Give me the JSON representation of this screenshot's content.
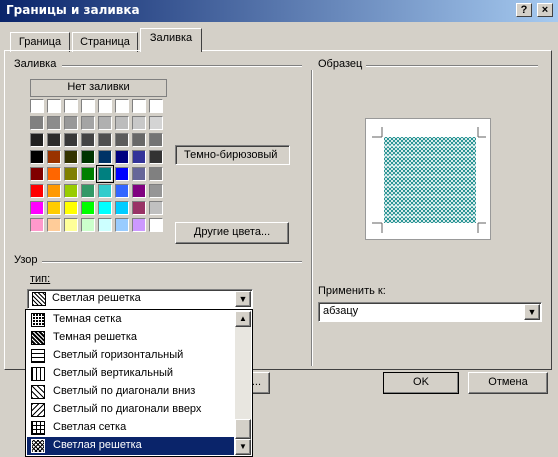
{
  "window": {
    "title": "Границы и заливка",
    "help_btn": "?",
    "close_btn": "×"
  },
  "tabs": [
    "Граница",
    "Страница",
    "Заливка"
  ],
  "fill": {
    "group_label": "Заливка",
    "no_fill_label": "Нет заливки",
    "selected_color_name": "Темно-бирюзовый",
    "other_colors_label": "Другие цвета...",
    "palette": [
      [
        "#ffffff",
        "#ffffff",
        "#ffffff",
        "#ffffff",
        "#ffffff",
        "#ffffff",
        "#ffffff",
        "#ffffff"
      ],
      [
        "#808080",
        "#8c8c8c",
        "#989898",
        "#a4a4a4",
        "#b0b0b0",
        "#bcbcbc",
        "#c8c8c8",
        "#d4d4d4"
      ],
      [
        "#202020",
        "#2c2c2c",
        "#383838",
        "#444444",
        "#505050",
        "#5c5c5c",
        "#686868",
        "#747474"
      ],
      [
        "#000000",
        "#993300",
        "#333300",
        "#003300",
        "#003366",
        "#000080",
        "#333399",
        "#333333"
      ],
      [
        "#800000",
        "#ff6600",
        "#808000",
        "#008000",
        "#008080",
        "#0000ff",
        "#666699",
        "#808080"
      ],
      [
        "#ff0000",
        "#ff9900",
        "#99cc00",
        "#339966",
        "#33cccc",
        "#3366ff",
        "#800080",
        "#969696"
      ],
      [
        "#ff00ff",
        "#ffcc00",
        "#ffff00",
        "#00ff00",
        "#00ffff",
        "#00ccff",
        "#993366",
        "#c0c0c0"
      ],
      [
        "#ff99cc",
        "#ffcc99",
        "#ffff99",
        "#ccffcc",
        "#ccffff",
        "#99ccff",
        "#cc99ff",
        "#ffffff"
      ]
    ],
    "selected_swatch": "#008080"
  },
  "pattern": {
    "group_label": "Узор",
    "type_label": "тип:",
    "type_value": "Светлая решетка",
    "options": [
      "Темная сетка",
      "Темная решетка",
      "Светлый горизонтальный",
      "Светлый вертикальный",
      "Светлый по диагонали вниз",
      "Светлый по диагонали вверх",
      "Светлая сетка",
      "Светлая решетка"
    ],
    "selected_option": "Светлая решетка"
  },
  "preview": {
    "group_label": "Образец",
    "apply_to_label": "Применить к:",
    "apply_to_value": "абзацу"
  },
  "buttons": {
    "ok": "OK",
    "cancel": "Отмена",
    "partial_left": "..."
  },
  "colors": {
    "accent": "#0a246a",
    "teal": "#008080",
    "face": "#d4d0c8"
  }
}
